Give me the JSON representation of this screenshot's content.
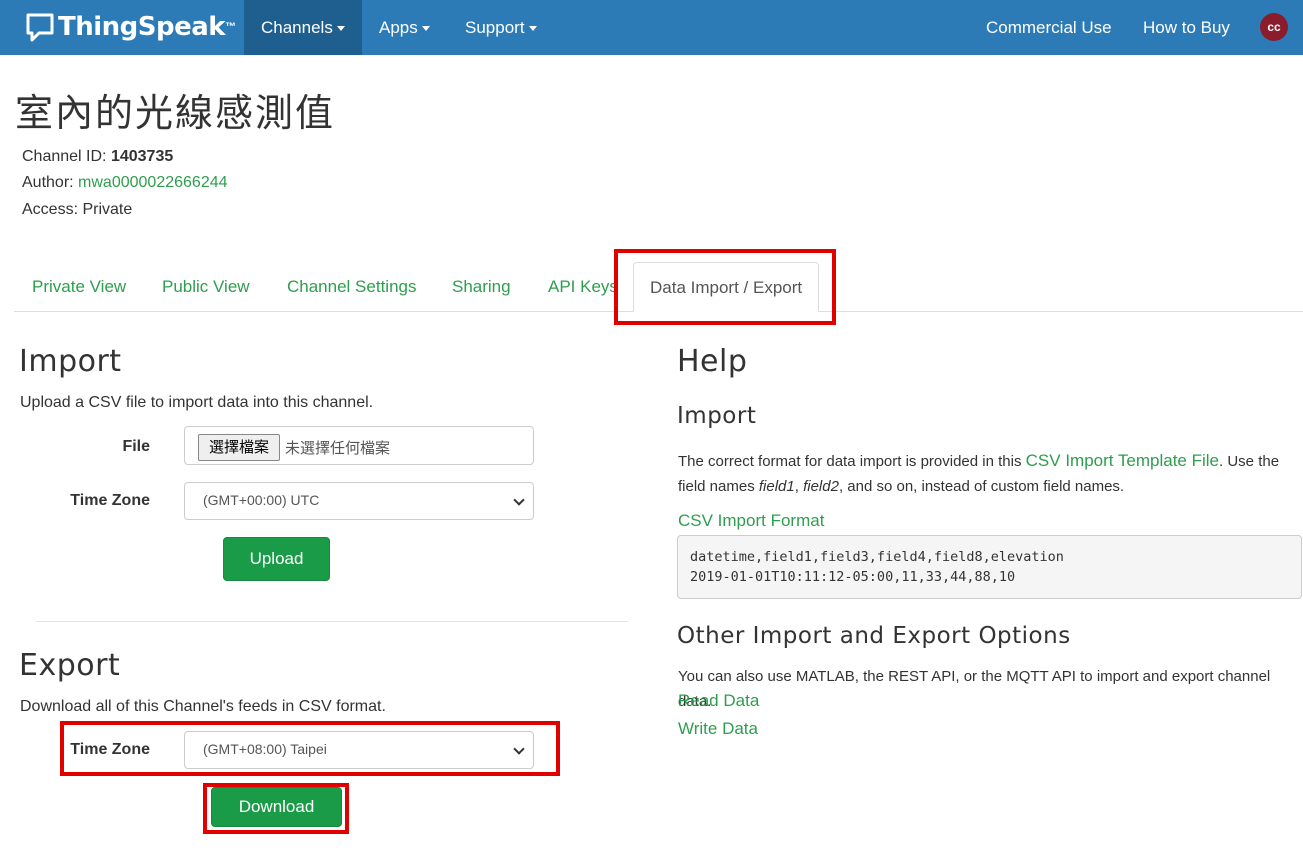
{
  "navbar": {
    "brand": "ThingSpeak",
    "brand_tm": "™",
    "items": [
      "Channels",
      "Apps",
      "Support"
    ],
    "right_items": [
      "Commercial Use",
      "How to Buy"
    ],
    "avatar_initials": "cc"
  },
  "channel": {
    "title": "室內的光線感測值",
    "id_label": "Channel ID:",
    "id_value": "1403735",
    "author_label": "Author:",
    "author_value": "mwa0000022666244",
    "access_label": "Access:",
    "access_value": "Private"
  },
  "tabs": [
    "Private View",
    "Public View",
    "Channel Settings",
    "Sharing",
    "API Keys",
    "Data Import / Export"
  ],
  "import": {
    "heading": "Import",
    "description": "Upload a CSV file to import data into this channel.",
    "file_label": "File",
    "file_button": "選擇檔案",
    "file_status": "未選擇任何檔案",
    "timezone_label": "Time Zone",
    "timezone_value": "(GMT+00:00) UTC",
    "upload_button": "Upload"
  },
  "export": {
    "heading": "Export",
    "description": "Download all of this Channel's feeds in CSV format.",
    "timezone_label": "Time Zone",
    "timezone_value": "(GMT+08:00) Taipei",
    "download_button": "Download"
  },
  "help": {
    "heading": "Help",
    "import_heading": "Import",
    "import_text_1": "The correct format for data import is provided in this ",
    "import_link": "CSV Import Template File",
    "import_text_2": ". Use the",
    "import_text_3_prefix": "field names ",
    "import_text_field1": "field1",
    "import_text_comma": ", ",
    "import_text_field2": "field2",
    "import_text_3_suffix": ", and so on, instead of custom field names.",
    "csv_format_link": "CSV Import Format",
    "code_line_1": "datetime,field1,field3,field4,field8,elevation",
    "code_line_2": "2019-01-01T10:11:12-05:00,11,33,44,88,10",
    "other_heading": "Other Import and Export Options",
    "other_text": "You can also use MATLAB, the REST API, or the MQTT API to import and export channel data.",
    "read_data_link": "Read Data",
    "write_data_link": "Write Data"
  },
  "colors": {
    "navbar": "#2d7bb6",
    "navbar_active": "#1f5f8f",
    "link_green": "#2e9e4e",
    "button_green": "#1a9b48",
    "highlight_red": "#e00000",
    "avatar": "#8a1c2c"
  }
}
